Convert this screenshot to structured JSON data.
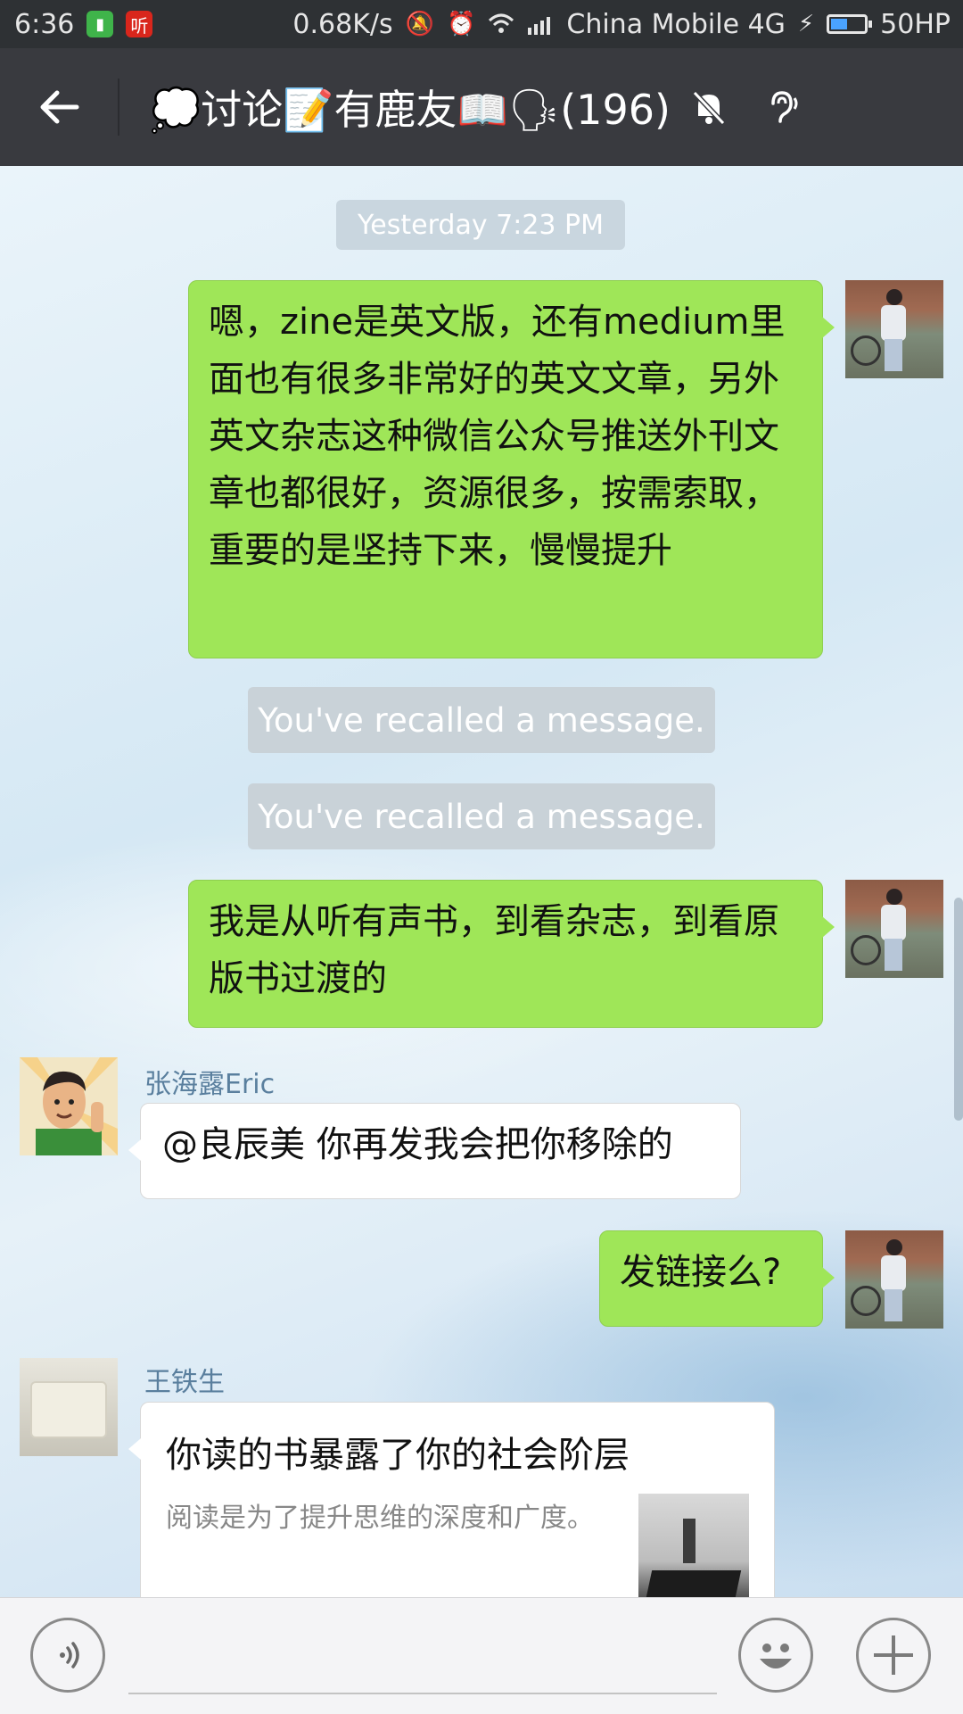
{
  "status_bar": {
    "time": "6:36",
    "app_badge_2": "听",
    "net_speed": "0.68K/s",
    "carrier": "China Mobile 4G",
    "battery_label": "50HP",
    "battery_level_fraction": 0.45
  },
  "header": {
    "title": "💭讨论📝有鹿友📖🗣(196)"
  },
  "chat": {
    "timestamp": "Yesterday 7:23 PM",
    "messages": [
      {
        "text": "嗯，zine是英文版，还有medium里面也有很多非常好的英文文章，另外英文杂志这种微信公众号推送外刊文章也都很好，资源很多，按需索取，重要的是坚持下来，慢慢提升"
      },
      {
        "text": "You've recalled a message."
      },
      {
        "text": "You've recalled a message."
      },
      {
        "text": "我是从听有声书，到看杂志，到看原版书过渡的"
      },
      {
        "sender": "张海露Eric",
        "text": "@良辰美 你再发我会把你移除的"
      },
      {
        "text": "发链接么?"
      },
      {
        "sender": "王铁生",
        "link_title": "你读的书暴露了你的社会阶层",
        "link_desc": "阅读是为了提升思维的深度和广度。"
      }
    ]
  },
  "colors": {
    "header_bg": "#393a3f",
    "my_bubble": "#9fe658",
    "other_bubble": "#ffffff",
    "sender_name": "#5a7f9e"
  }
}
